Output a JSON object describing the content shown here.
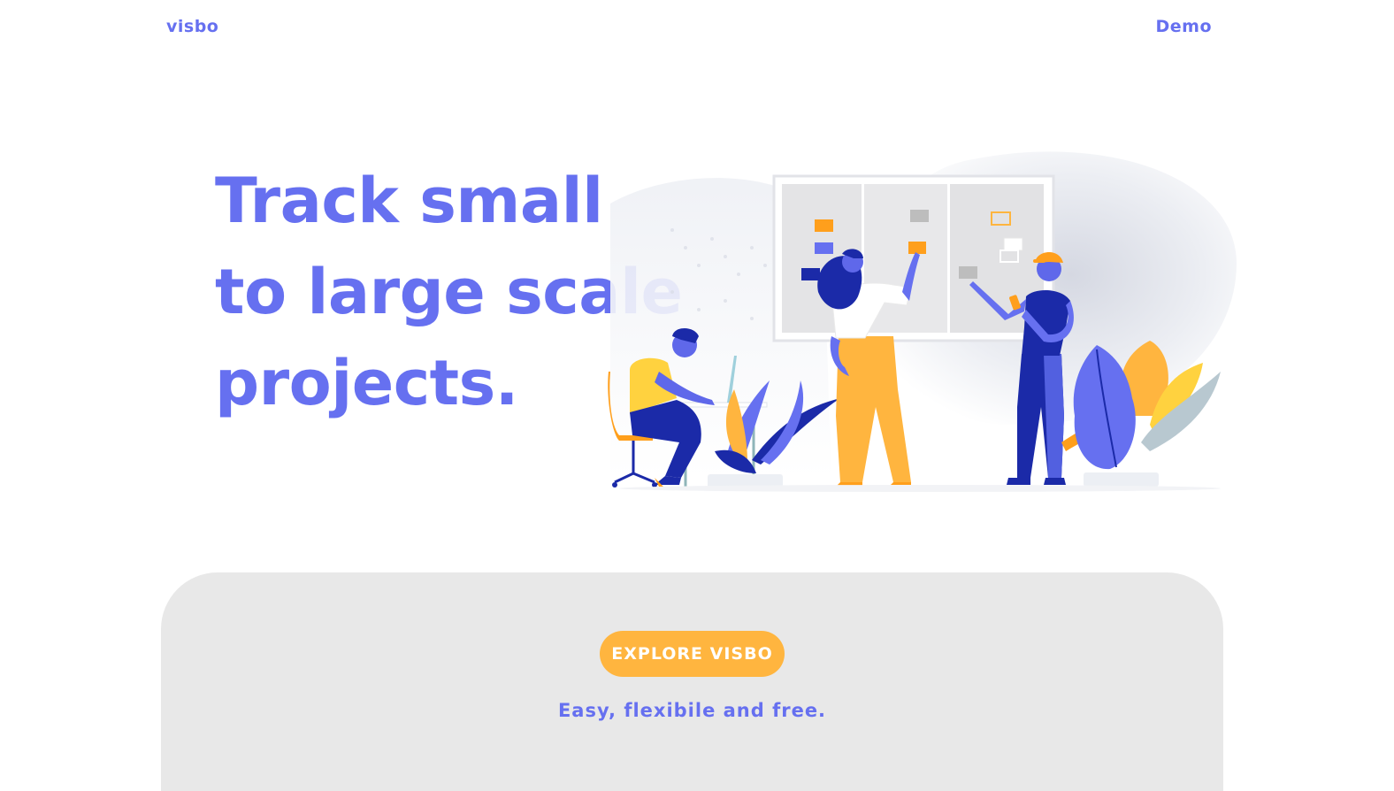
{
  "header": {
    "brand": "visbo",
    "demo_link": "Demo"
  },
  "hero": {
    "title_lines": [
      "Track small",
      "to large scale",
      "projects."
    ],
    "illustration": "team-working-at-kanban-board-illustration"
  },
  "cta": {
    "button_label": "EXPLORE VISBO",
    "tagline": "Easy, flexibile and free."
  },
  "colors": {
    "primary": "#6670f0",
    "accent": "#ffb53f",
    "panel": "#e8e8e8",
    "navy": "#1b2aa8",
    "orange": "#ff9f1c"
  }
}
